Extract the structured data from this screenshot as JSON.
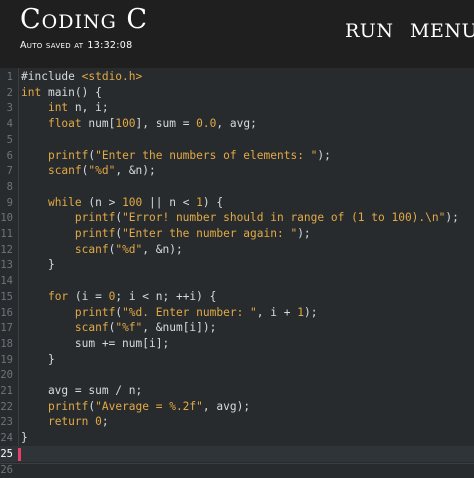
{
  "app": {
    "title": "Coding C",
    "saved_label": "Auto saved at",
    "saved_time": "13:32:08"
  },
  "actions": {
    "run": "RUN",
    "menu": "MENU"
  },
  "editor": {
    "current_line": 25,
    "lines": [
      {
        "n": "1",
        "segments": [
          {
            "t": "#include ",
            "c": "pp"
          },
          {
            "t": "<stdio.h>",
            "c": "hdr"
          }
        ]
      },
      {
        "n": "2",
        "segments": [
          {
            "t": "int ",
            "c": "ty"
          },
          {
            "t": "main() {",
            "c": "pl"
          }
        ]
      },
      {
        "n": "3",
        "segments": [
          {
            "t": "    ",
            "c": "pl"
          },
          {
            "t": "int ",
            "c": "ty"
          },
          {
            "t": "n, i;",
            "c": "pl"
          }
        ]
      },
      {
        "n": "4",
        "segments": [
          {
            "t": "    ",
            "c": "pl"
          },
          {
            "t": "float ",
            "c": "ty"
          },
          {
            "t": "num[",
            "c": "pl"
          },
          {
            "t": "100",
            "c": "nm"
          },
          {
            "t": "], sum = ",
            "c": "pl"
          },
          {
            "t": "0.0",
            "c": "nm"
          },
          {
            "t": ", avg;",
            "c": "pl"
          }
        ]
      },
      {
        "n": "5",
        "segments": []
      },
      {
        "n": "6",
        "segments": [
          {
            "t": "    ",
            "c": "pl"
          },
          {
            "t": "printf",
            "c": "fn"
          },
          {
            "t": "(",
            "c": "pl"
          },
          {
            "t": "\"Enter the numbers of elements: \"",
            "c": "st"
          },
          {
            "t": ");",
            "c": "pl"
          }
        ]
      },
      {
        "n": "7",
        "segments": [
          {
            "t": "    ",
            "c": "pl"
          },
          {
            "t": "scanf",
            "c": "fn"
          },
          {
            "t": "(",
            "c": "pl"
          },
          {
            "t": "\"%d\"",
            "c": "st"
          },
          {
            "t": ", &n);",
            "c": "pl"
          }
        ]
      },
      {
        "n": "8",
        "segments": []
      },
      {
        "n": "9",
        "segments": [
          {
            "t": "    ",
            "c": "pl"
          },
          {
            "t": "while",
            "c": "kw"
          },
          {
            "t": " (n > ",
            "c": "pl"
          },
          {
            "t": "100",
            "c": "nm"
          },
          {
            "t": " || n < ",
            "c": "pl"
          },
          {
            "t": "1",
            "c": "nm"
          },
          {
            "t": ") {",
            "c": "pl"
          }
        ]
      },
      {
        "n": "10",
        "segments": [
          {
            "t": "        ",
            "c": "pl"
          },
          {
            "t": "printf",
            "c": "fn"
          },
          {
            "t": "(",
            "c": "pl"
          },
          {
            "t": "\"Error! number should in range of (1 to 100).\\n\"",
            "c": "st"
          },
          {
            "t": ");",
            "c": "pl"
          }
        ]
      },
      {
        "n": "11",
        "segments": [
          {
            "t": "        ",
            "c": "pl"
          },
          {
            "t": "printf",
            "c": "fn"
          },
          {
            "t": "(",
            "c": "pl"
          },
          {
            "t": "\"Enter the number again: \"",
            "c": "st"
          },
          {
            "t": ");",
            "c": "pl"
          }
        ]
      },
      {
        "n": "12",
        "segments": [
          {
            "t": "        ",
            "c": "pl"
          },
          {
            "t": "scanf",
            "c": "fn"
          },
          {
            "t": "(",
            "c": "pl"
          },
          {
            "t": "\"%d\"",
            "c": "st"
          },
          {
            "t": ", &n);",
            "c": "pl"
          }
        ]
      },
      {
        "n": "13",
        "segments": [
          {
            "t": "    }",
            "c": "pl"
          }
        ]
      },
      {
        "n": "14",
        "segments": []
      },
      {
        "n": "15",
        "segments": [
          {
            "t": "    ",
            "c": "pl"
          },
          {
            "t": "for",
            "c": "kw"
          },
          {
            "t": " (i = ",
            "c": "pl"
          },
          {
            "t": "0",
            "c": "nm"
          },
          {
            "t": "; i < n; ++i) {",
            "c": "pl"
          }
        ]
      },
      {
        "n": "16",
        "segments": [
          {
            "t": "        ",
            "c": "pl"
          },
          {
            "t": "printf",
            "c": "fn"
          },
          {
            "t": "(",
            "c": "pl"
          },
          {
            "t": "\"%d. Enter number: \"",
            "c": "st"
          },
          {
            "t": ", i + ",
            "c": "pl"
          },
          {
            "t": "1",
            "c": "nm"
          },
          {
            "t": ");",
            "c": "pl"
          }
        ]
      },
      {
        "n": "17",
        "segments": [
          {
            "t": "        ",
            "c": "pl"
          },
          {
            "t": "scanf",
            "c": "fn"
          },
          {
            "t": "(",
            "c": "pl"
          },
          {
            "t": "\"%f\"",
            "c": "st"
          },
          {
            "t": ", &num[i]);",
            "c": "pl"
          }
        ]
      },
      {
        "n": "18",
        "segments": [
          {
            "t": "        sum += num[i];",
            "c": "pl"
          }
        ]
      },
      {
        "n": "19",
        "segments": [
          {
            "t": "    }",
            "c": "pl"
          }
        ]
      },
      {
        "n": "20",
        "segments": []
      },
      {
        "n": "21",
        "segments": [
          {
            "t": "    avg = sum / n;",
            "c": "pl"
          }
        ]
      },
      {
        "n": "22",
        "segments": [
          {
            "t": "    ",
            "c": "pl"
          },
          {
            "t": "printf",
            "c": "fn"
          },
          {
            "t": "(",
            "c": "pl"
          },
          {
            "t": "\"Average = %.2f\"",
            "c": "st"
          },
          {
            "t": ", avg);",
            "c": "pl"
          }
        ]
      },
      {
        "n": "23",
        "segments": [
          {
            "t": "    ",
            "c": "pl"
          },
          {
            "t": "return",
            "c": "kw"
          },
          {
            "t": " ",
            "c": "pl"
          },
          {
            "t": "0",
            "c": "nm"
          },
          {
            "t": ";",
            "c": "pl"
          }
        ]
      },
      {
        "n": "24",
        "segments": [
          {
            "t": "}",
            "c": "pl"
          }
        ]
      },
      {
        "n": "25",
        "segments": []
      },
      {
        "n": "26",
        "segments": []
      }
    ]
  },
  "colors": {
    "background": "#272b2e",
    "appbar": "#1f1f1f",
    "syntax_accent": "#e2a945",
    "cursor": "#e83e6c"
  }
}
